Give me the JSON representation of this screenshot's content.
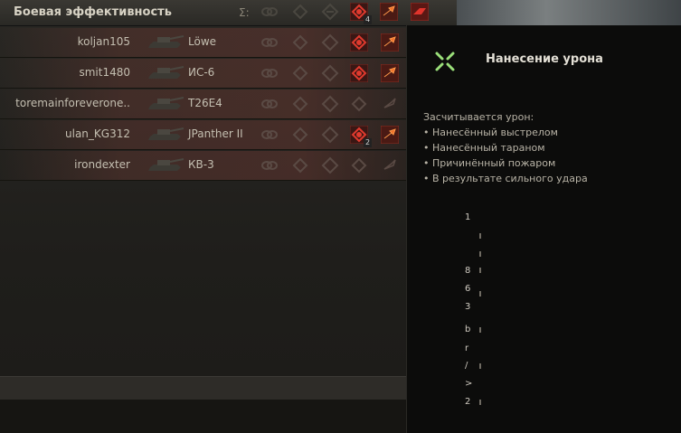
{
  "header": {
    "title": "Боевая эффективность",
    "sigma": "Σ:"
  },
  "rows": [
    {
      "player": "koljan105",
      "tank": "Löwe",
      "count": ""
    },
    {
      "player": "smit1480",
      "tank": "ИС-6",
      "count": ""
    },
    {
      "player": "toremainforeverone..",
      "tank": "T26E4",
      "count": ""
    },
    {
      "player": "ulan_KG312",
      "tank": "JPanther II",
      "count": "2"
    },
    {
      "player": "irondexter",
      "tank": "КВ-3",
      "count": ""
    }
  ],
  "header_count": "4",
  "tooltip": {
    "title": "Нанесение урона",
    "intro": "Засчитывается урон:",
    "items": [
      "• Нанесённый выстрелом",
      "• Нанесённый тараном",
      "• Причинённый пожаром",
      "• В результате сильного удара"
    ],
    "glyphs": [
      "1",
      "8",
      "6",
      "3",
      "b",
      "r",
      "/",
      ">",
      "2"
    ]
  },
  "colors": {
    "accent_red": "#c0282a",
    "tooltip_bg": "#0c0c0b",
    "crosshair": "#9be07a"
  }
}
